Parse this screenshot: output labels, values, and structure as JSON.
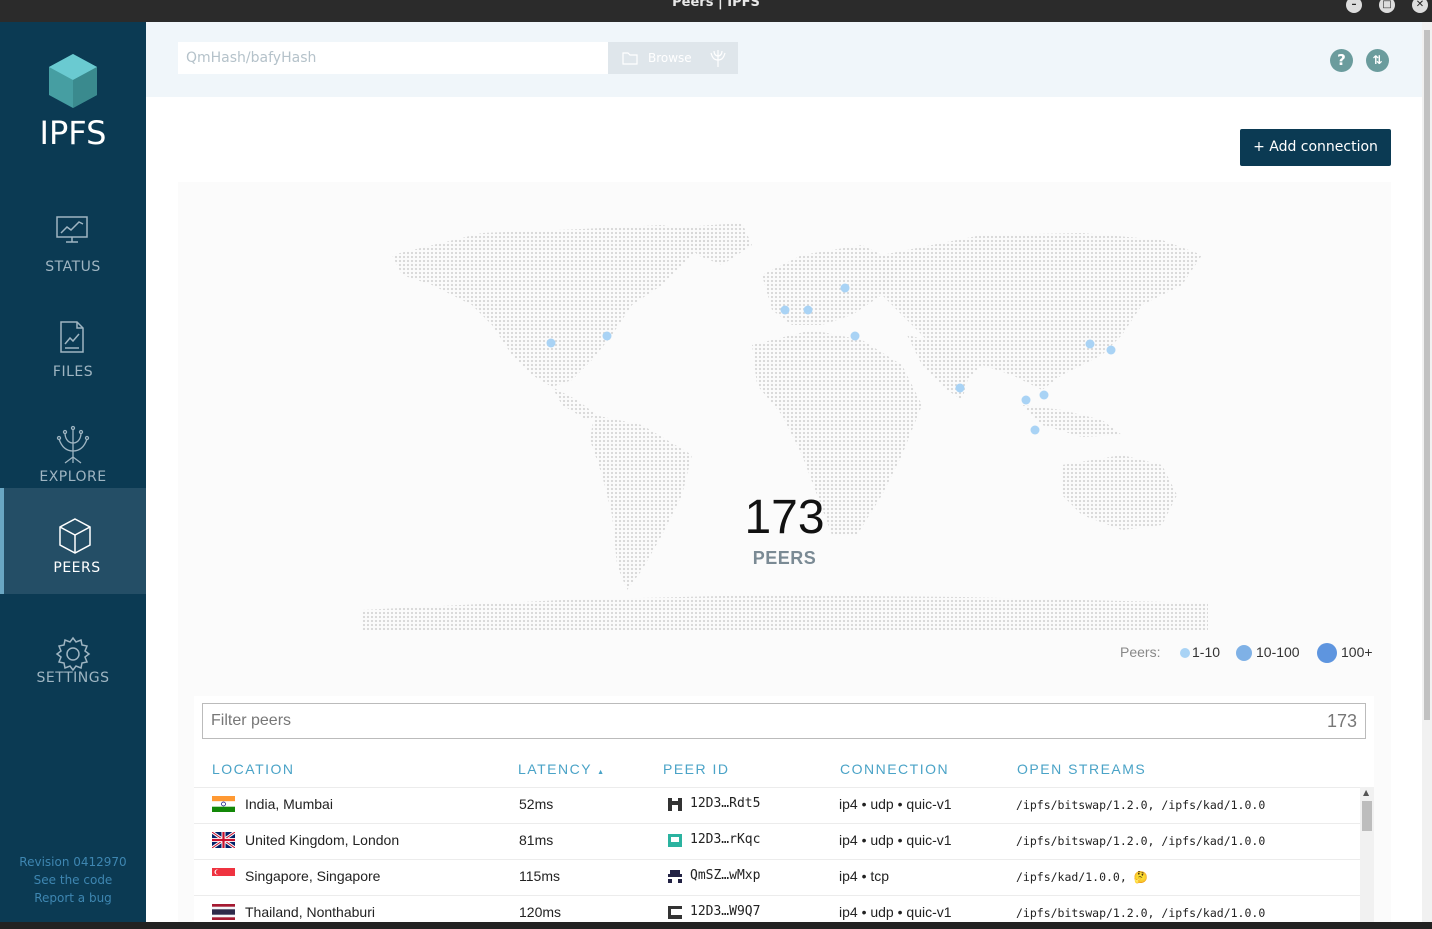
{
  "window": {
    "title": "Peers | IPFS",
    "controls": [
      "minimize",
      "maximize",
      "close"
    ]
  },
  "sidebar": {
    "logo_text": "IPFS",
    "items": [
      {
        "label": "STATUS",
        "icon": "status-chart-icon"
      },
      {
        "label": "FILES",
        "icon": "files-document-icon"
      },
      {
        "label": "EXPLORE",
        "icon": "explore-tree-icon"
      },
      {
        "label": "PEERS",
        "icon": "peers-cube-icon",
        "active": true
      },
      {
        "label": "SETTINGS",
        "icon": "settings-gear-icon"
      }
    ],
    "footer": {
      "revision": "Revision 0412970",
      "see_code": "See the code",
      "report_bug": "Report a bug"
    }
  },
  "topbar": {
    "search_placeholder": "QmHash/bafyHash",
    "browse_label": "Browse",
    "help_icon": "help-icon",
    "sync_icon": "sync-arrows-icon"
  },
  "peers_page": {
    "add_connection_label": "+ Add connection",
    "peer_count": "173",
    "peer_label": "PEERS",
    "legend": {
      "title": "Peers:",
      "small": "1-10",
      "medium": "10-100",
      "large": "100+"
    },
    "filter_placeholder": "Filter peers",
    "filter_count": "173"
  },
  "table": {
    "headers": {
      "location": "LOCATION",
      "latency": "LATENCY",
      "peer_id": "PEER ID",
      "connection": "CONNECTION",
      "streams": "OPEN STREAMS"
    },
    "sort_indicator": "▲",
    "rows": [
      {
        "flag": "india",
        "location": "India, Mumbai",
        "latency": "52ms",
        "peer_id": "12D3…Rdt5",
        "connection": "ip4 • udp • quic-v1",
        "streams": "/ipfs/bitswap/1.2.0, /ipfs/kad/1.0.0"
      },
      {
        "flag": "uk",
        "location": "United Kingdom, London",
        "latency": "81ms",
        "peer_id": "12D3…rKqc",
        "connection": "ip4 • udp • quic-v1",
        "streams": "/ipfs/bitswap/1.2.0, /ipfs/kad/1.0.0"
      },
      {
        "flag": "singapore",
        "location": "Singapore, Singapore",
        "latency": "115ms",
        "peer_id": "QmSZ…wMxp",
        "connection": "ip4 • tcp",
        "streams": "/ipfs/kad/1.0.0, 🤔"
      },
      {
        "flag": "thailand",
        "location": "Thailand, Nonthaburi",
        "latency": "120ms",
        "peer_id": "12D3…W9Q7",
        "connection": "ip4 • udp • quic-v1",
        "streams": "/ipfs/bitswap/1.2.0, /ipfs/kad/1.0.0"
      }
    ]
  },
  "colors": {
    "sidebar": "#0b3a53",
    "accent": "#4aa3c7",
    "map_dot": "#a9d3f5",
    "legend_mid": "#7fb1e6",
    "legend_large": "#5e95df"
  }
}
